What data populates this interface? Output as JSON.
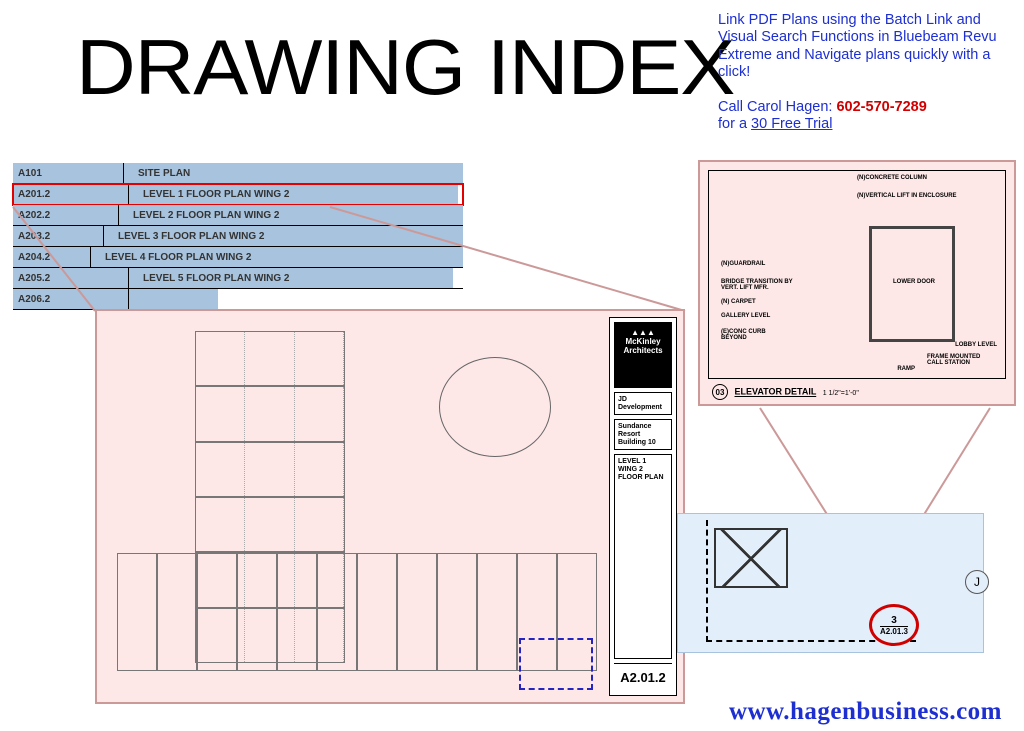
{
  "title": "DRAWING INDEX",
  "promo": {
    "line1": "Link PDF Plans using the Batch Link and Visual Search Functions in Bluebeam Revu Extreme and Navigate plans quickly with a click!",
    "call_prefix": "Call Carol Hagen: ",
    "phone": "602-570-7289",
    "trial_prefix": "for a ",
    "trial_link": "30 Free Trial"
  },
  "index_rows": [
    {
      "code": "A101",
      "desc": "SITE PLAN"
    },
    {
      "code": "A201.2",
      "desc": "LEVEL 1 FLOOR PLAN WING 2",
      "selected": true
    },
    {
      "code": "A202.2",
      "desc": "LEVEL 2 FLOOR PLAN WING 2"
    },
    {
      "code": "A203.2",
      "desc": "LEVEL 3 FLOOR PLAN WING 2"
    },
    {
      "code": "A204.2",
      "desc": "LEVEL 4 FLOOR PLAN WING 2"
    },
    {
      "code": "A205.2",
      "desc": "LEVEL 5 FLOOR PLAN WING 2"
    },
    {
      "code": "A206.2",
      "desc": ""
    }
  ],
  "plan": {
    "architect": "McKinley Architects",
    "blk1_title": "JD Development",
    "blk2_title": "Sundance Resort Building 10",
    "blk3_title": "LEVEL 1\nWING 2\nFLOOR PLAN",
    "sheet_no": "A2.01.2"
  },
  "detail": {
    "notes": {
      "a": "(N)CONCRETE COLUMN",
      "b": "(N)VERTICAL LIFT IN ENCLOSURE",
      "c": "(N)GUARDRAIL",
      "bridge": "BRIDGE TRANSITION BY VERT. LIFT MFR.",
      "carpet": "(N) CARPET",
      "gallery": "GALLERY LEVEL",
      "curb": "(E)CONC CURB BEYOND",
      "lower": "LOWER DOOR",
      "ramp": "RAMP",
      "lobby": "LOBBY LEVEL",
      "frame": "FRAME MOUNTED CALL STATION"
    },
    "title_num": "03",
    "title_text": "ELEVATOR DETAIL",
    "title_scale": "1 1/2\"=1'-0\""
  },
  "mini": {
    "j": "J",
    "call_top": "3",
    "call_bot": "A2.01.3"
  },
  "website": "www.hagenbusiness.com"
}
